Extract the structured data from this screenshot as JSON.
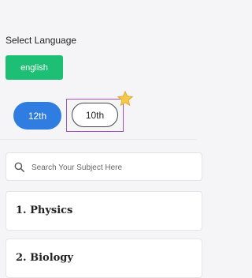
{
  "language": {
    "label": "Select Language",
    "selected": "english"
  },
  "grades": {
    "option_12": "12th",
    "option_10": "10th"
  },
  "search": {
    "placeholder": "Search Your Subject Here"
  },
  "subjects": [
    {
      "label": "1. Physics"
    },
    {
      "label": "2. Biology"
    }
  ],
  "colors": {
    "accent_green": "#1dbf74",
    "accent_blue": "#2f7de1",
    "highlight_border": "#a052b8",
    "star": "#f2c94c"
  },
  "icons": {
    "search": "search-icon",
    "star": "star-icon"
  }
}
